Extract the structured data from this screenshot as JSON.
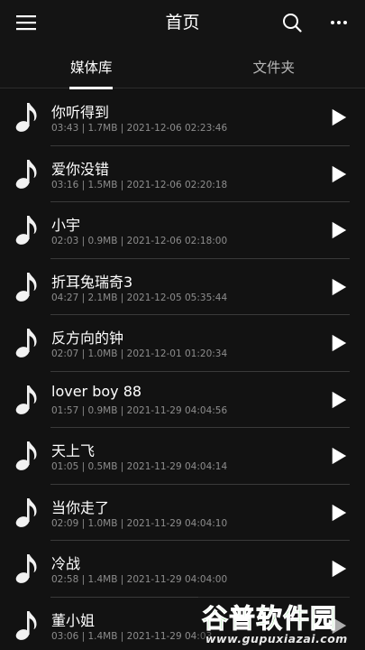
{
  "header": {
    "title": "首页",
    "icons": {
      "menu": "menu-icon",
      "search": "search-icon",
      "more": "more-icon"
    }
  },
  "tabs": [
    {
      "label": "媒体库",
      "active": true
    },
    {
      "label": "文件夹",
      "active": false
    }
  ],
  "songs": [
    {
      "title": "你听得到",
      "meta": "03:43 | 1.7MB | 2021-12-06 02:23:46"
    },
    {
      "title": "爱你没错",
      "meta": "03:16 | 1.5MB | 2021-12-06 02:20:18"
    },
    {
      "title": "小宇",
      "meta": "02:03 | 0.9MB | 2021-12-06 02:18:00"
    },
    {
      "title": "折耳兔瑞奇3",
      "meta": "04:27 | 2.1MB | 2021-12-05 05:35:44"
    },
    {
      "title": "反方向的钟",
      "meta": "02:07 | 1.0MB | 2021-12-01 01:20:34"
    },
    {
      "title": "lover boy 88",
      "meta": "01:57 | 0.9MB | 2021-11-29 04:04:56"
    },
    {
      "title": "天上飞",
      "meta": "01:05 | 0.5MB | 2021-11-29 04:04:14"
    },
    {
      "title": "当你走了",
      "meta": "02:09 | 1.0MB | 2021-11-29 04:04:10"
    },
    {
      "title": "冷战",
      "meta": "02:58 | 1.4MB | 2021-11-29 04:04:00"
    },
    {
      "title": "董小姐",
      "meta": "03:06 | 1.4MB | 2021-11-29 04:03"
    }
  ],
  "watermark": {
    "logo": "谷普软件园",
    "url": "www.gupuxiazai.com"
  },
  "colors": {
    "background": "#121212",
    "divider": "#3a3a3a",
    "meta_text": "#8d8d8d",
    "watermark_green": "#3fb93c"
  }
}
